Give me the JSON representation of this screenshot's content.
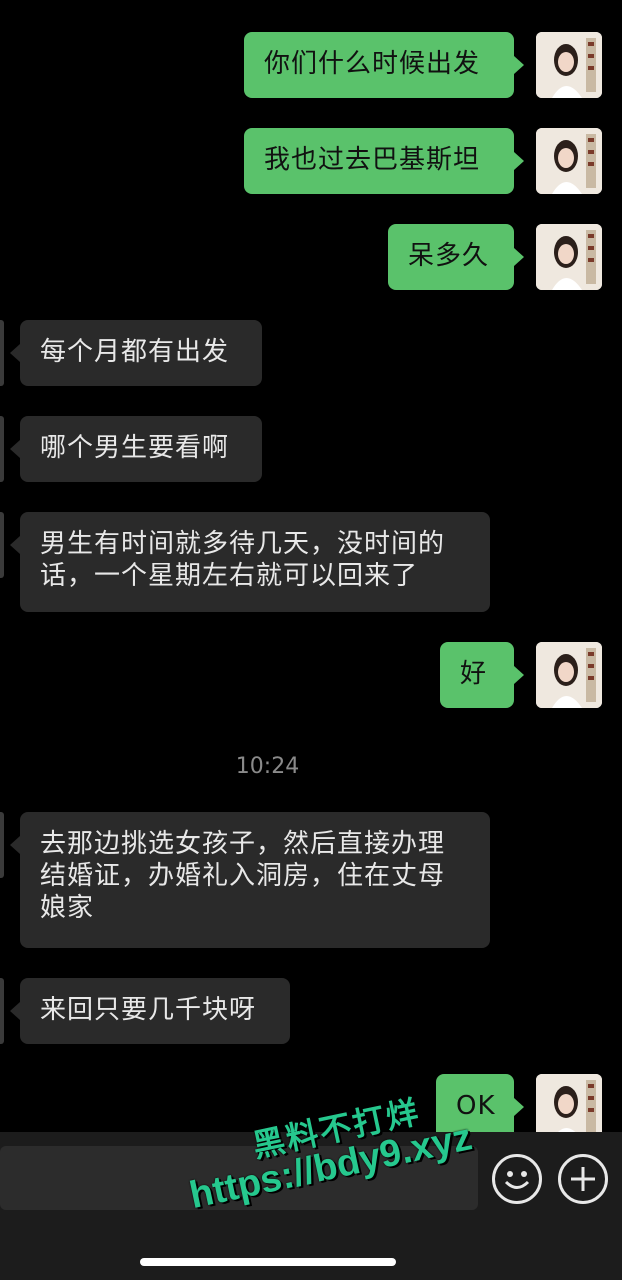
{
  "messages": [
    {
      "dir": "out",
      "text": "你们什么时候出发"
    },
    {
      "dir": "out",
      "text": "我也过去巴基斯坦"
    },
    {
      "dir": "out",
      "text": "呆多久"
    },
    {
      "dir": "in",
      "text": "每个月都有出发"
    },
    {
      "dir": "in",
      "text": "哪个男生要看啊"
    },
    {
      "dir": "in",
      "lines": [
        "男生有时间就多待几天，没时间的",
        "话，一个星期左右就可以回来了"
      ]
    },
    {
      "dir": "out",
      "text": "好"
    },
    {
      "dir": "in",
      "lines": [
        "去那边挑选女孩子，然后直接办理",
        "结婚证，办婚礼入洞房，住在丈母",
        "娘家"
      ]
    },
    {
      "dir": "in",
      "text": "来回只要几千块呀"
    },
    {
      "dir": "out",
      "text": "OK"
    }
  ],
  "timestamp": "10:24",
  "watermark": {
    "line1": "黑料不打烊",
    "line2": "https://bdy9.xyz"
  },
  "input_bar": {
    "emoji_icon": "emoji-icon",
    "plus_icon": "plus-icon"
  },
  "colors": {
    "outgoing": "#5ac26b",
    "incoming": "#2a2a2a",
    "background": "#000000",
    "watermark": "#26c88e"
  }
}
